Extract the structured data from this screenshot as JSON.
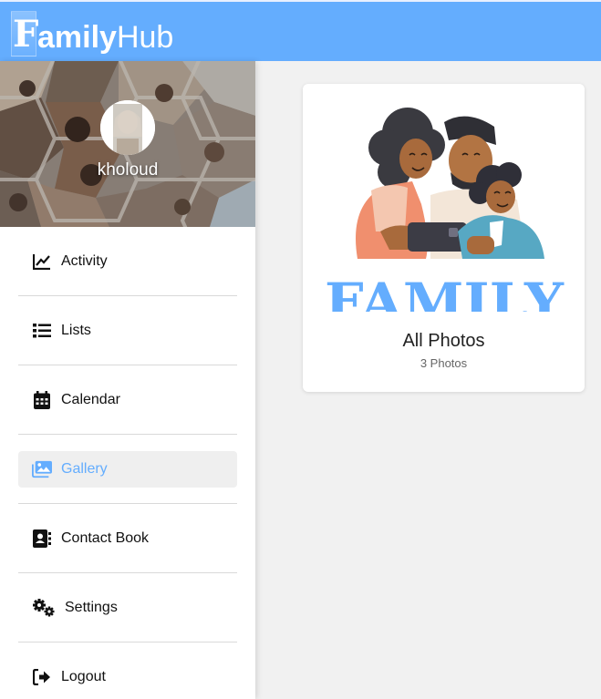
{
  "app": {
    "logo_first_letter": "F",
    "logo_rest_bold": "amily",
    "logo_suffix": "Hub",
    "brand_color": "#64adfe"
  },
  "profile": {
    "username": "kholoud"
  },
  "sidebar": {
    "items": [
      {
        "label": "Activity",
        "icon": "chart-line-icon",
        "active": false
      },
      {
        "label": "Lists",
        "icon": "list-icon",
        "active": false
      },
      {
        "label": "Calendar",
        "icon": "calendar-icon",
        "active": false
      },
      {
        "label": "Gallery",
        "icon": "images-icon",
        "active": true
      },
      {
        "label": "Contact Book",
        "icon": "address-book-icon",
        "active": false
      },
      {
        "label": "Settings",
        "icon": "gears-icon",
        "active": false
      },
      {
        "label": "Logout",
        "icon": "logout-icon",
        "active": false
      }
    ],
    "active_color": "#64adfe"
  },
  "gallery": {
    "album": {
      "title": "All Photos",
      "count_text": "3 Photos",
      "image_word": "FAMILY"
    }
  }
}
